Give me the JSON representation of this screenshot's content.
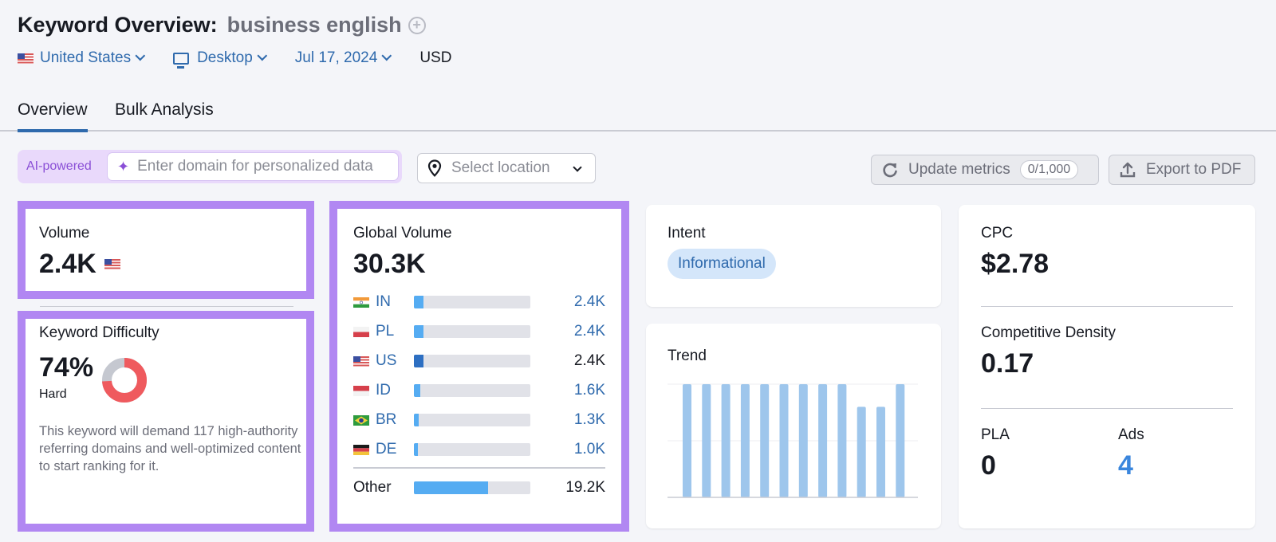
{
  "header": {
    "title": "Keyword Overview:",
    "keyword": "business english",
    "add_icon": "plus-circle-icon"
  },
  "filters": {
    "country": "United States",
    "device": "Desktop",
    "date": "Jul 17, 2024",
    "currency": "USD"
  },
  "tabs": [
    {
      "label": "Overview",
      "active": true
    },
    {
      "label": "Bulk Analysis",
      "active": false
    }
  ],
  "toolbar": {
    "ai_label": "AI-powered",
    "domain_placeholder": "Enter domain for personalized data",
    "domain_value": "",
    "location_placeholder": "Select location",
    "update_label": "Update metrics",
    "update_badge": "0/1,000",
    "export_label": "Export to PDF"
  },
  "volume": {
    "label": "Volume",
    "value": "2.4K"
  },
  "keyword_difficulty": {
    "label": "Keyword Difficulty",
    "value": "74%",
    "percent": 74,
    "level": "Hard",
    "description": "This keyword will demand 117 high-authority referring domains and well-optimized content to start ranking for it.",
    "colors": {
      "filled": "#ef5a5e",
      "empty": "#c5c8d0"
    }
  },
  "global_volume": {
    "label": "Global Volume",
    "value": "30.3K",
    "countries": [
      {
        "code": "IN",
        "value": "2.4K",
        "share": 0.079,
        "highlight": false
      },
      {
        "code": "PL",
        "value": "2.4K",
        "share": 0.079,
        "highlight": false
      },
      {
        "code": "US",
        "value": "2.4K",
        "share": 0.079,
        "highlight": true
      },
      {
        "code": "ID",
        "value": "1.6K",
        "share": 0.053,
        "highlight": false
      },
      {
        "code": "BR",
        "value": "1.3K",
        "share": 0.043,
        "highlight": false
      },
      {
        "code": "DE",
        "value": "1.0K",
        "share": 0.033,
        "highlight": false
      }
    ],
    "other": {
      "label": "Other",
      "value": "19.2K",
      "share": 0.634
    }
  },
  "intent": {
    "label": "Intent",
    "value": "Informational"
  },
  "trend": {
    "label": "Trend",
    "bar_color": "#9ec6ec",
    "values": [
      1,
      1,
      1,
      1,
      1,
      1,
      1,
      1,
      1,
      0.8,
      0.8,
      1
    ]
  },
  "cpc": {
    "label": "CPC",
    "value": "$2.78"
  },
  "competitive_density": {
    "label": "Competitive Density",
    "value": "0.17"
  },
  "pla": {
    "label": "PLA",
    "value": "0"
  },
  "ads": {
    "label": "Ads",
    "value": "4"
  },
  "colors": {
    "highlight_border": "#b187f2",
    "link_blue": "#2f6aad",
    "bar_light": "#55acf2",
    "bar_dark": "#2d6fc2"
  }
}
